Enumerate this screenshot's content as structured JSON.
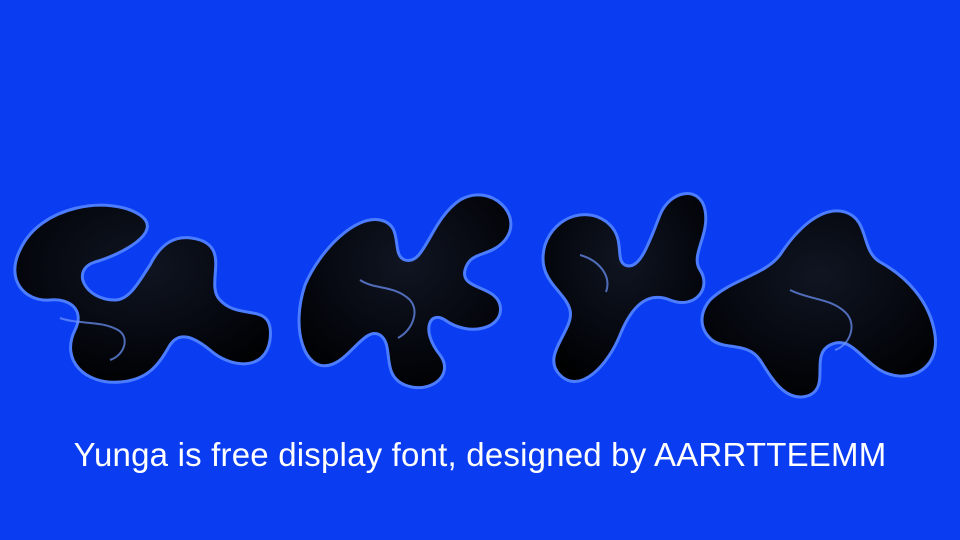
{
  "background_color": "#0a3cf2",
  "artwork": {
    "description_name": "yunga-wordmark-artwork",
    "glyph_color": "#05070f",
    "highlight_color": "#4d7dff"
  },
  "caption": {
    "text": "Yunga is free display font, designed by AARRTTEEMM",
    "color": "#ffffff"
  }
}
